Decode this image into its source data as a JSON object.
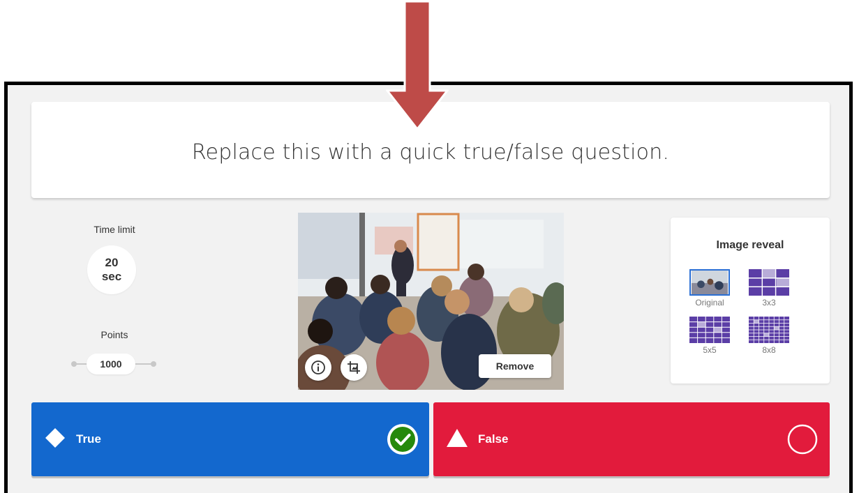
{
  "question": {
    "text": "Replace this with a quick true/false question."
  },
  "time_limit": {
    "label": "Time limit",
    "value": "20",
    "unit": "sec"
  },
  "points": {
    "label": "Points",
    "value": "1000"
  },
  "media": {
    "remove_label": "Remove",
    "info_icon": "info-icon",
    "crop_icon": "crop-image-icon"
  },
  "image_reveal": {
    "title": "Image reveal",
    "options": [
      {
        "label": "Original",
        "selected": true
      },
      {
        "label": "3x3",
        "selected": false
      },
      {
        "label": "5x5",
        "selected": false
      },
      {
        "label": "8x8",
        "selected": false
      }
    ]
  },
  "answers": [
    {
      "label": "True",
      "shape": "diamond-icon",
      "color": "#1368ce",
      "correct": true
    },
    {
      "label": "False",
      "shape": "triangle-icon",
      "color": "#e21b3c",
      "correct": false
    }
  ],
  "colors": {
    "accent_arrow": "#be4b48",
    "selected_outline": "#2a6fd4",
    "correct_check": "#26890c",
    "reveal_tile": "#5b3ea6"
  }
}
